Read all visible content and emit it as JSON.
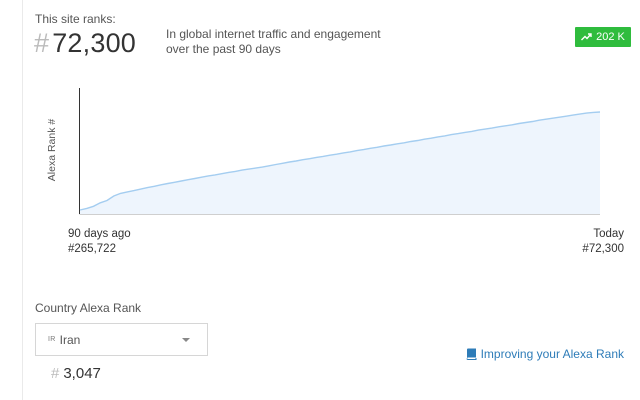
{
  "rank": {
    "label": "This site ranks:",
    "hash_symbol": "#",
    "value": "72,300",
    "description": "In global internet traffic and engagement over the past 90 days"
  },
  "delta_badge": {
    "icon": "trending-up-icon",
    "text": "202 K",
    "color": "#2fbc3d"
  },
  "chart_data": {
    "type": "area",
    "ylabel": "Alexa Rank #",
    "x_labels": {
      "start": "90 days ago",
      "start_value": "#265,722",
      "end": "Today",
      "end_value": "#72,300"
    },
    "series": [
      {
        "values": [
          265722,
          262500,
          258500,
          251500,
          247000,
          238000,
          233000,
          230000,
          227500,
          224500,
          221500,
          219000,
          216000,
          213500,
          211000,
          208500,
          206000,
          203500,
          201000,
          198500,
          196500,
          194000,
          191500,
          189500,
          187000,
          185000,
          183000,
          181000,
          178500,
          176000,
          173500,
          171000,
          169000,
          166500,
          164500,
          162000,
          160000,
          157500,
          155500,
          153000,
          151000,
          148500,
          146500,
          144000,
          142000,
          139500,
          137500,
          135000,
          133000,
          130500,
          128500,
          126000,
          124000,
          121500,
          119500,
          117000,
          115000,
          112500,
          110500,
          108000,
          106000,
          104000,
          101500,
          99500,
          97500,
          95000,
          93000,
          91000,
          88500,
          86500,
          84500,
          82500,
          80500,
          78500,
          76500,
          74500,
          73000,
          72300
        ]
      }
    ],
    "line_color": "#a4cdf0",
    "fill_color": "#eef5fd",
    "grid": false
  },
  "country": {
    "label": "Country Alexa Rank",
    "flag_code": "IR",
    "name": "Iran",
    "hash_symbol": "#",
    "rank": "3,047"
  },
  "link": {
    "icon": "book-icon",
    "text": "Improving your Alexa Rank",
    "color": "#2e7cb8"
  }
}
